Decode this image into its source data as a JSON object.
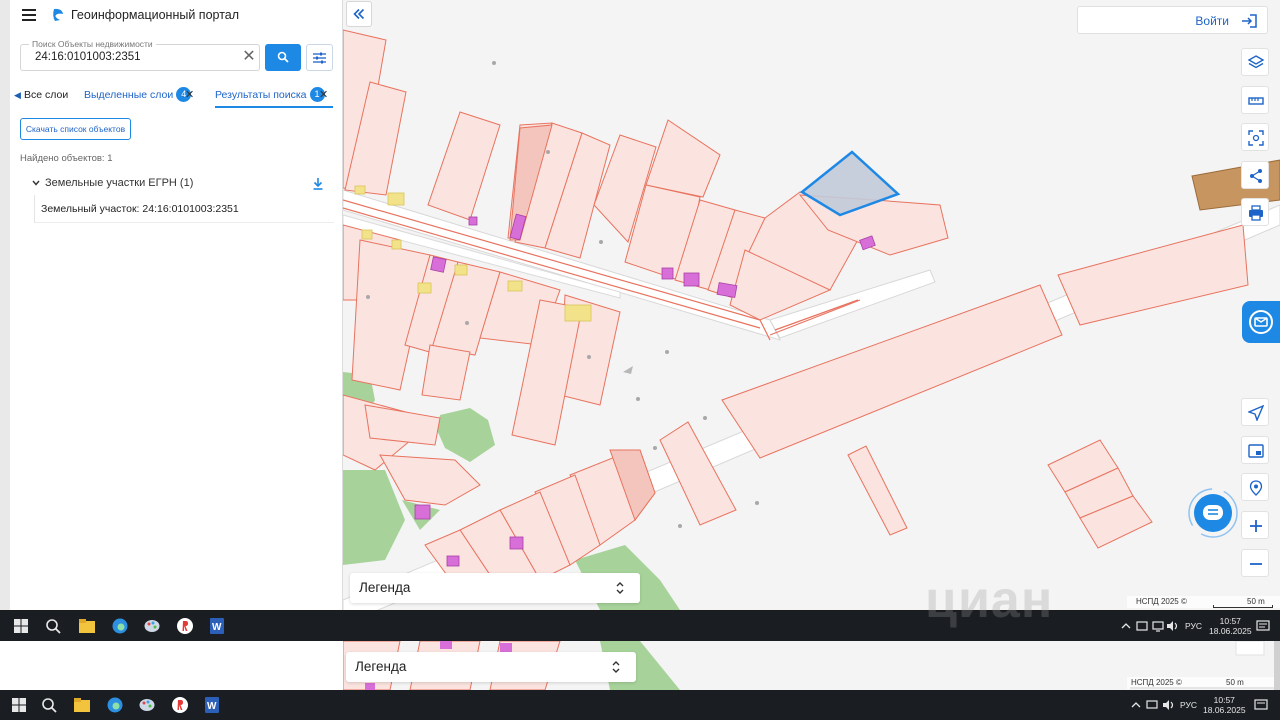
{
  "app": {
    "title": "Геоинформационный портал"
  },
  "search": {
    "label": "Поиск Объекты недвижимости",
    "value": "24:16:0101003:2351",
    "clear_icon": "close-icon",
    "search_icon": "search-icon",
    "filter_icon": "filter-icon"
  },
  "tabs": {
    "all": {
      "label": "Все слои"
    },
    "selected": {
      "label": "Выделенные слои",
      "count": "4"
    },
    "results": {
      "label": "Результаты поиска",
      "count": "1"
    }
  },
  "results": {
    "download_label": "Скачать список объектов",
    "found_text": "Найдено объектов: 1",
    "group_label": "Земельные участки ЕГРН (1)",
    "items": [
      {
        "label": "Земельный участок: 24:16:0101003:2351"
      }
    ]
  },
  "header": {
    "login_label": "Войти"
  },
  "map_controls": [
    "layers-icon",
    "ruler-icon",
    "screenshot-icon",
    "share-icon",
    "print-icon",
    "navigate-icon",
    "minimap-icon",
    "locate-icon",
    "zoom-in-icon",
    "zoom-out-icon"
  ],
  "legend": {
    "label": "Легенда"
  },
  "attribution": {
    "text": "НСПД 2025 ©",
    "scale": "50 m"
  },
  "taskbar": {
    "lang": "РУС",
    "time": "10:57",
    "date": "18.06.2025"
  },
  "watermark": "циан",
  "colors": {
    "accent": "#1e88e5",
    "parcel_fill": "#fbe3df",
    "parcel_stroke": "#e8735f",
    "selected_parcel": "#c2cad9",
    "building": "#d86fd8",
    "vegetation": "#a7d39a",
    "orange_parcel": "#c69560"
  }
}
